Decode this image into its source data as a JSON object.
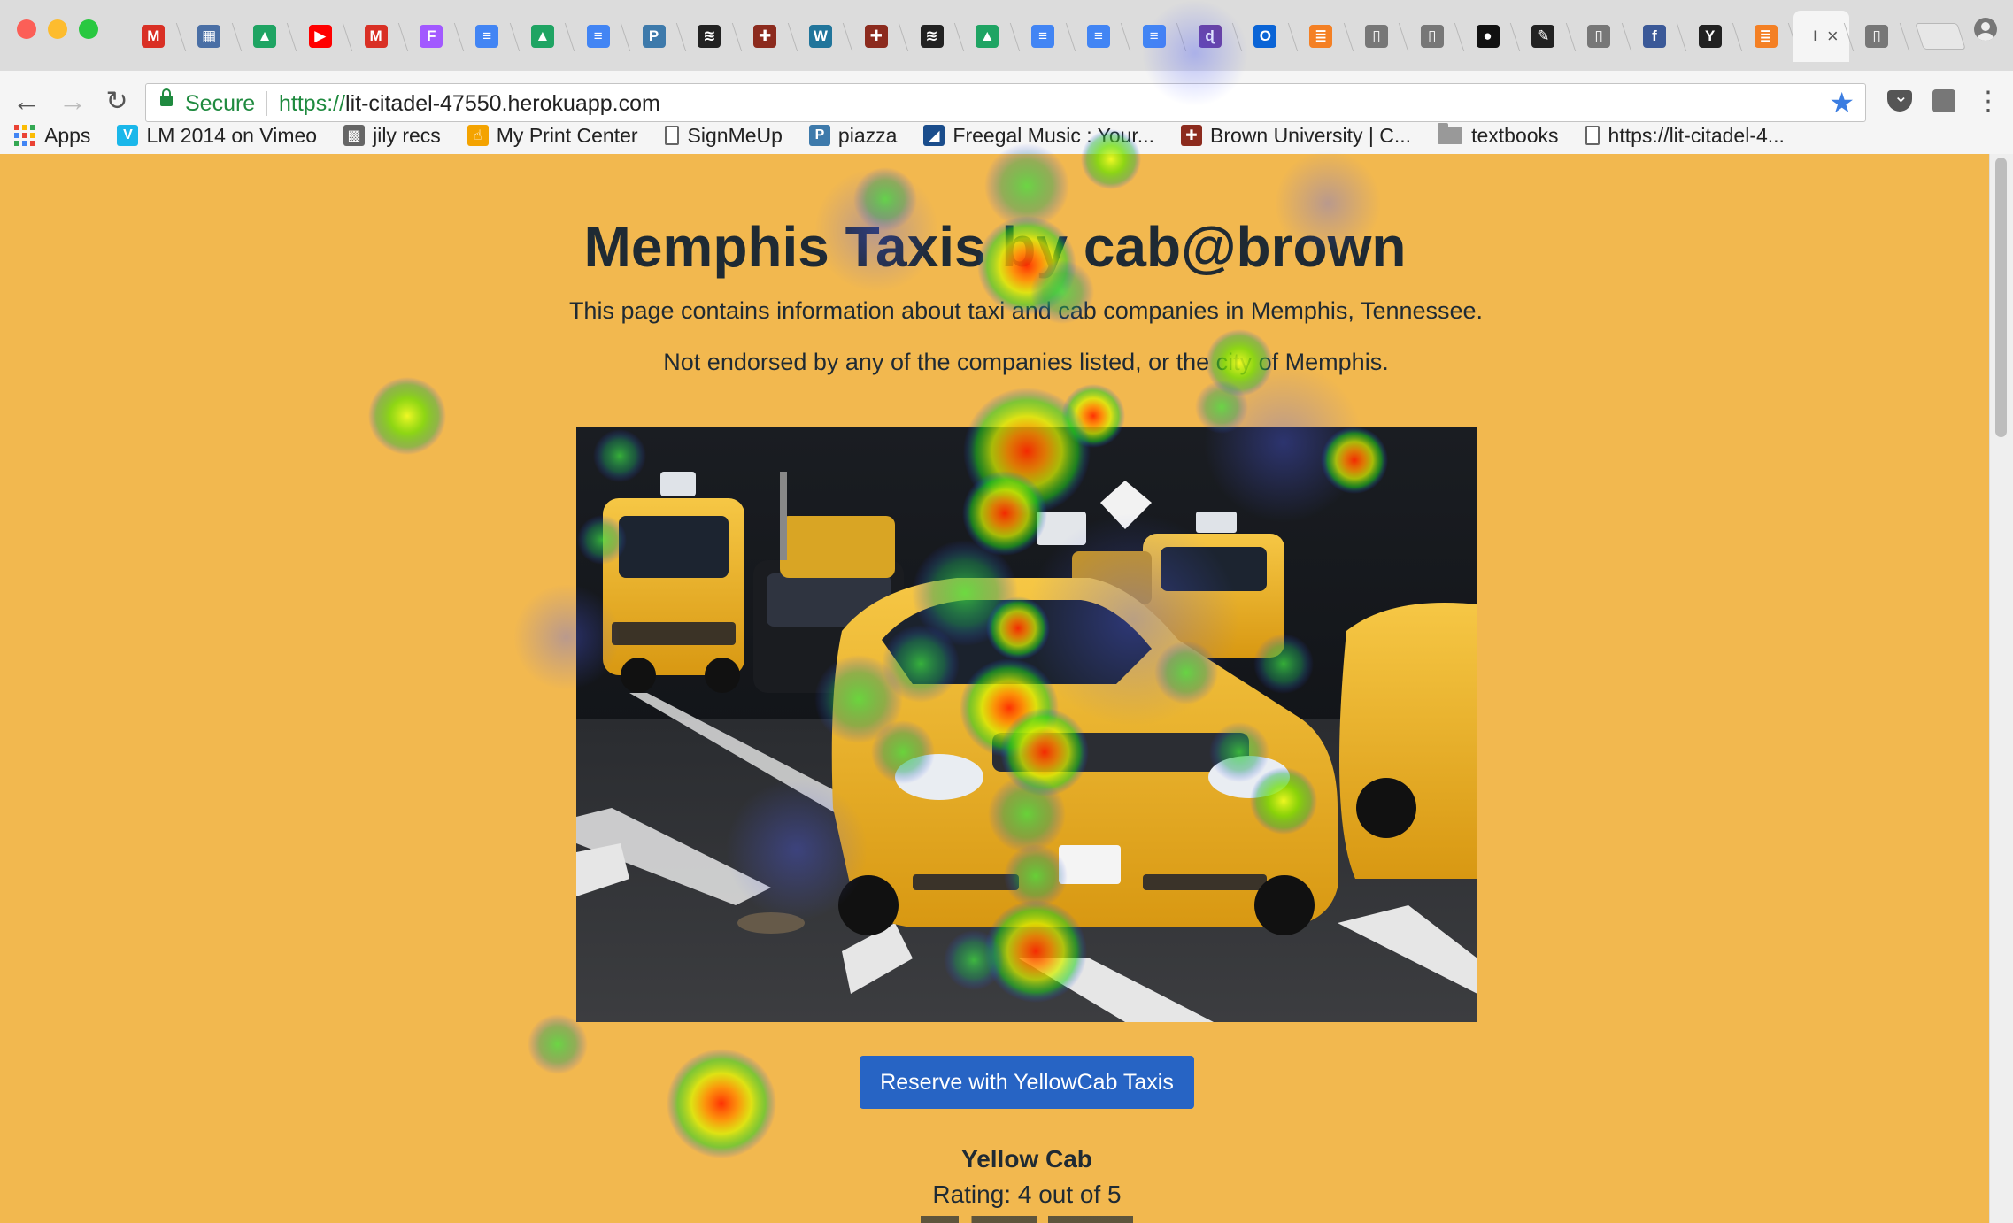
{
  "browser": {
    "tabs": [
      {
        "icon": "gmail-icon",
        "glyph": "M",
        "color": "#d93025"
      },
      {
        "icon": "image-icon",
        "glyph": "▦",
        "color": "#4a6fa5"
      },
      {
        "icon": "google-drive-icon",
        "glyph": "▲",
        "color": "#1fa463"
      },
      {
        "icon": "youtube-icon",
        "glyph": "▶",
        "color": "#ff0000"
      },
      {
        "icon": "gmail-icon",
        "glyph": "M",
        "color": "#d93025"
      },
      {
        "icon": "figma-icon",
        "glyph": "F",
        "color": "#a259ff"
      },
      {
        "icon": "google-docs-icon",
        "glyph": "≡",
        "color": "#4285f4"
      },
      {
        "icon": "google-drive-icon",
        "glyph": "▲",
        "color": "#1fa463"
      },
      {
        "icon": "google-docs-icon",
        "glyph": "≡",
        "color": "#4285f4"
      },
      {
        "icon": "piazza-icon",
        "glyph": "P",
        "color": "#3e7aab"
      },
      {
        "icon": "stripes-icon",
        "glyph": "≋",
        "color": "#222222"
      },
      {
        "icon": "brown-shield-icon",
        "glyph": "✚",
        "color": "#8c2b1e"
      },
      {
        "icon": "wordpress-icon",
        "glyph": "W",
        "color": "#21759b"
      },
      {
        "icon": "brown-shield-icon",
        "glyph": "✚",
        "color": "#8c2b1e"
      },
      {
        "icon": "stripes-icon",
        "glyph": "≋",
        "color": "#222222"
      },
      {
        "icon": "google-drive-icon",
        "glyph": "▲",
        "color": "#1fa463"
      },
      {
        "icon": "google-docs-icon",
        "glyph": "≡",
        "color": "#4285f4"
      },
      {
        "icon": "google-docs-icon",
        "glyph": "≡",
        "color": "#4285f4"
      },
      {
        "icon": "google-docs-icon",
        "glyph": "≡",
        "color": "#4285f4"
      },
      {
        "icon": "dictionary-icon",
        "glyph": "ɖ",
        "color": "#6a3d9a"
      },
      {
        "icon": "outlook-icon",
        "glyph": "O",
        "color": "#0a64d6"
      },
      {
        "icon": "stackoverflow-icon",
        "glyph": "≣",
        "color": "#f48024"
      },
      {
        "icon": "page-icon",
        "glyph": "▯",
        "color": "#777777"
      },
      {
        "icon": "page-icon",
        "glyph": "▯",
        "color": "#777777"
      },
      {
        "icon": "github-icon",
        "glyph": "●",
        "color": "#111111"
      },
      {
        "icon": "edit-icon",
        "glyph": "✎",
        "color": "#222222"
      },
      {
        "icon": "page-icon",
        "glyph": "▯",
        "color": "#777777"
      },
      {
        "icon": "facebook-icon",
        "glyph": "f",
        "color": "#3b5998"
      },
      {
        "icon": "ycombinator-icon",
        "glyph": "Y",
        "color": "#222222"
      },
      {
        "icon": "stackoverflow-icon",
        "glyph": "≣",
        "color": "#f48024"
      },
      {
        "icon": "active-tab-icon",
        "glyph": "I",
        "color": "#555555",
        "active": true
      },
      {
        "icon": "page-icon",
        "glyph": "▯",
        "color": "#777777"
      }
    ],
    "active_tab_close": "×",
    "secure_label": "Secure",
    "url_scheme": "https://",
    "url_host": "lit-citadel-47550.herokuapp.com",
    "bookmarks": [
      {
        "name": "bookmark-apps",
        "label": "Apps",
        "icon": "apps-icon"
      },
      {
        "name": "bookmark-vimeo",
        "label": "LM 2014 on Vimeo",
        "icon": "vimeo-icon",
        "glyph": "V",
        "color": "#1ab7ea"
      },
      {
        "name": "bookmark-jily",
        "label": "jily recs",
        "icon": "image-icon",
        "glyph": "▩",
        "color": "#666666"
      },
      {
        "name": "bookmark-print",
        "label": "My Print Center",
        "icon": "hand-icon",
        "glyph": "☝",
        "color": "#f4a300"
      },
      {
        "name": "bookmark-signmeup",
        "label": "SignMeUp",
        "icon": "page-icon"
      },
      {
        "name": "bookmark-piazza",
        "label": "piazza",
        "icon": "piazza-icon",
        "glyph": "P",
        "color": "#3e7aab"
      },
      {
        "name": "bookmark-freegal",
        "label": "Freegal Music : Your...",
        "icon": "freegal-icon",
        "glyph": "◢",
        "color": "#1a4d8c"
      },
      {
        "name": "bookmark-brown",
        "label": "Brown University | C...",
        "icon": "brown-shield-icon",
        "glyph": "✚",
        "color": "#8c2b1e"
      },
      {
        "name": "bookmark-textbooks",
        "label": "textbooks",
        "icon": "folder-icon"
      },
      {
        "name": "bookmark-citadel",
        "label": "https://lit-citadel-4...",
        "icon": "page-icon"
      }
    ]
  },
  "page": {
    "title": "Memphis Taxis by cab@brown",
    "description": "This page contains information about taxi and cab companies in Memphis, Tennessee.",
    "disclaimer": "Not endorsed by any of the companies listed, or the city of Memphis.",
    "reserve_label": "Reserve with YellowCab Taxis",
    "company_name": "Yellow Cab",
    "rating_text": "Rating: 4 out of 5"
  },
  "colors": {
    "page_background": "#f2b84f",
    "heading_text": "#1f2a33",
    "button_blue": "#2764c4",
    "secure_green": "#1f8a3f",
    "taxi_yellow": "#f0b21d"
  }
}
